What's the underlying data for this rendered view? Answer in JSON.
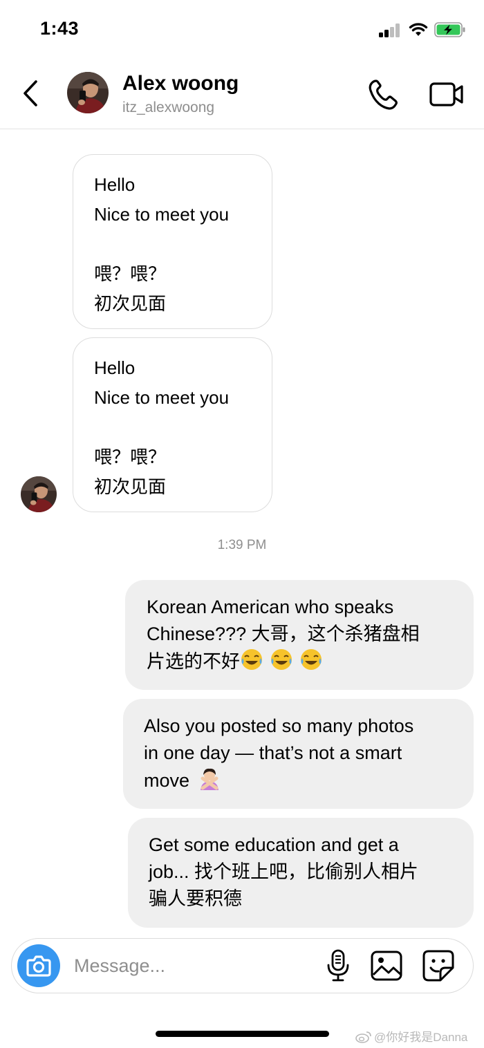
{
  "status_bar": {
    "time": "1:43",
    "icons": [
      "signal-icon",
      "wifi-icon",
      "battery-charging-icon"
    ]
  },
  "header": {
    "name": "Alex woong",
    "handle": "itz_alexwoong",
    "icons": [
      "back-icon",
      "avatar",
      "phone-call-icon",
      "video-call-icon"
    ]
  },
  "messages_in": [
    {
      "lines": [
        "Hello",
        "Nice to meet you",
        "",
        "喂？喂？",
        "初次见面"
      ]
    },
    {
      "lines": [
        "Hello",
        "Nice to meet you",
        "",
        "喂？喂？",
        "初次见面"
      ]
    }
  ],
  "timestamp": "1:39 PM",
  "messages_out": [
    {
      "lines": [
        "Korean American who speaks",
        "Chinese??? 大哥，这个杀猪盘相",
        "片选的不好"
      ],
      "emoji": "face-with-tears-of-joy-emoji x3"
    },
    {
      "lines": [
        "Also you posted so many photos",
        "in one day — that’s not a smart",
        "move"
      ],
      "emoji": "person-gesturing-no-emoji"
    },
    {
      "lines": [
        "Get some education and get a",
        "job... 找个班上吧，比偷别人相片",
        "骗人要积德"
      ]
    }
  ],
  "composer": {
    "placeholder": "Message...",
    "icons": [
      "camera-icon",
      "microphone-icon",
      "gallery-icon",
      "sticker-icon"
    ]
  },
  "watermark": "@你好我是Danna",
  "colors": {
    "accent_blue": "#3797f0",
    "outgoing_bubble": "#efefef",
    "incoming_border": "#dcdcdc",
    "secondary_text": "#8e8e8e",
    "battery_green": "#34c759"
  }
}
